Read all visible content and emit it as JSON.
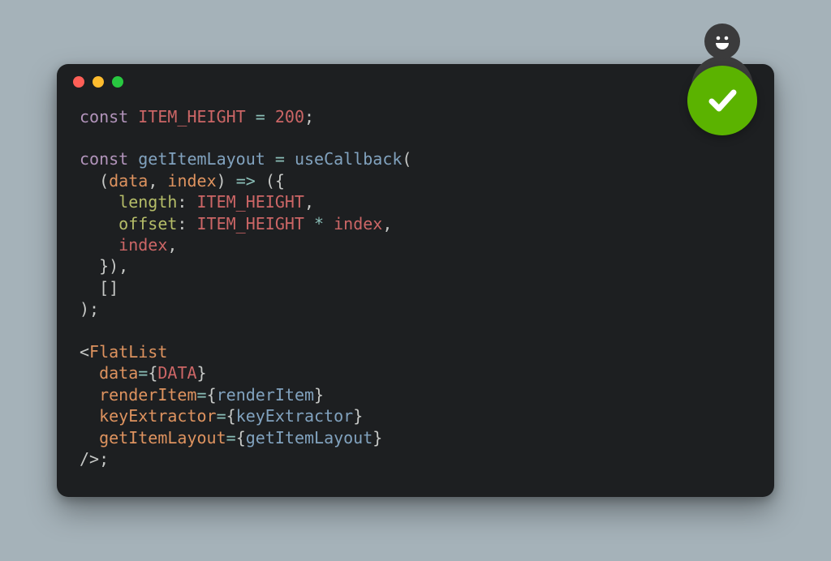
{
  "window": {
    "dot_colors": {
      "red": "#ff5f57",
      "yellow": "#febc2e",
      "green": "#28c840"
    }
  },
  "badge": {
    "type": "checkmark",
    "color": "#5bb300"
  },
  "avatar": {
    "expression": "smile",
    "color": "#3b3b3c"
  },
  "code": {
    "lines": [
      [
        {
          "cls": "tok-kw",
          "t": "const"
        },
        {
          "cls": "tok-plain",
          "t": " "
        },
        {
          "cls": "tok-var",
          "t": "ITEM_HEIGHT"
        },
        {
          "cls": "tok-plain",
          "t": " "
        },
        {
          "cls": "tok-op",
          "t": "="
        },
        {
          "cls": "tok-plain",
          "t": " "
        },
        {
          "cls": "tok-num",
          "t": "200"
        },
        {
          "cls": "tok-punc",
          "t": ";"
        }
      ],
      [],
      [
        {
          "cls": "tok-kw",
          "t": "const"
        },
        {
          "cls": "tok-plain",
          "t": " "
        },
        {
          "cls": "tok-func",
          "t": "getItemLayout"
        },
        {
          "cls": "tok-plain",
          "t": " "
        },
        {
          "cls": "tok-op",
          "t": "="
        },
        {
          "cls": "tok-plain",
          "t": " "
        },
        {
          "cls": "tok-func",
          "t": "useCallback"
        },
        {
          "cls": "tok-punc",
          "t": "("
        }
      ],
      [
        {
          "cls": "tok-plain",
          "t": "  "
        },
        {
          "cls": "tok-punc",
          "t": "("
        },
        {
          "cls": "tok-param",
          "t": "data"
        },
        {
          "cls": "tok-punc",
          "t": ","
        },
        {
          "cls": "tok-plain",
          "t": " "
        },
        {
          "cls": "tok-param",
          "t": "index"
        },
        {
          "cls": "tok-punc",
          "t": ")"
        },
        {
          "cls": "tok-plain",
          "t": " "
        },
        {
          "cls": "tok-op",
          "t": "=>"
        },
        {
          "cls": "tok-plain",
          "t": " "
        },
        {
          "cls": "tok-punc",
          "t": "({"
        }
      ],
      [
        {
          "cls": "tok-plain",
          "t": "    "
        },
        {
          "cls": "tok-prop",
          "t": "length"
        },
        {
          "cls": "tok-punc",
          "t": ":"
        },
        {
          "cls": "tok-plain",
          "t": " "
        },
        {
          "cls": "tok-var",
          "t": "ITEM_HEIGHT"
        },
        {
          "cls": "tok-punc",
          "t": ","
        }
      ],
      [
        {
          "cls": "tok-plain",
          "t": "    "
        },
        {
          "cls": "tok-prop",
          "t": "offset"
        },
        {
          "cls": "tok-punc",
          "t": ":"
        },
        {
          "cls": "tok-plain",
          "t": " "
        },
        {
          "cls": "tok-var",
          "t": "ITEM_HEIGHT"
        },
        {
          "cls": "tok-plain",
          "t": " "
        },
        {
          "cls": "tok-op",
          "t": "*"
        },
        {
          "cls": "tok-plain",
          "t": " "
        },
        {
          "cls": "tok-var",
          "t": "index"
        },
        {
          "cls": "tok-punc",
          "t": ","
        }
      ],
      [
        {
          "cls": "tok-plain",
          "t": "    "
        },
        {
          "cls": "tok-var",
          "t": "index"
        },
        {
          "cls": "tok-punc",
          "t": ","
        }
      ],
      [
        {
          "cls": "tok-plain",
          "t": "  "
        },
        {
          "cls": "tok-punc",
          "t": "}),"
        }
      ],
      [
        {
          "cls": "tok-plain",
          "t": "  "
        },
        {
          "cls": "tok-punc",
          "t": "[]"
        }
      ],
      [
        {
          "cls": "tok-punc",
          "t": ");"
        }
      ],
      [],
      [
        {
          "cls": "tok-punc",
          "t": "<"
        },
        {
          "cls": "tok-tag",
          "t": "FlatList"
        }
      ],
      [
        {
          "cls": "tok-plain",
          "t": "  "
        },
        {
          "cls": "tok-attr",
          "t": "data"
        },
        {
          "cls": "tok-op",
          "t": "="
        },
        {
          "cls": "tok-punc",
          "t": "{"
        },
        {
          "cls": "tok-var",
          "t": "DATA"
        },
        {
          "cls": "tok-punc",
          "t": "}"
        }
      ],
      [
        {
          "cls": "tok-plain",
          "t": "  "
        },
        {
          "cls": "tok-attr",
          "t": "renderItem"
        },
        {
          "cls": "tok-op",
          "t": "="
        },
        {
          "cls": "tok-punc",
          "t": "{"
        },
        {
          "cls": "tok-ident",
          "t": "renderItem"
        },
        {
          "cls": "tok-punc",
          "t": "}"
        }
      ],
      [
        {
          "cls": "tok-plain",
          "t": "  "
        },
        {
          "cls": "tok-attr",
          "t": "keyExtractor"
        },
        {
          "cls": "tok-op",
          "t": "="
        },
        {
          "cls": "tok-punc",
          "t": "{"
        },
        {
          "cls": "tok-ident",
          "t": "keyExtractor"
        },
        {
          "cls": "tok-punc",
          "t": "}"
        }
      ],
      [
        {
          "cls": "tok-plain",
          "t": "  "
        },
        {
          "cls": "tok-attr",
          "t": "getItemLayout"
        },
        {
          "cls": "tok-op",
          "t": "="
        },
        {
          "cls": "tok-punc",
          "t": "{"
        },
        {
          "cls": "tok-ident",
          "t": "getItemLayout"
        },
        {
          "cls": "tok-punc",
          "t": "}"
        }
      ],
      [
        {
          "cls": "tok-punc",
          "t": "/>"
        },
        {
          "cls": "tok-punc",
          "t": ";"
        }
      ]
    ]
  }
}
